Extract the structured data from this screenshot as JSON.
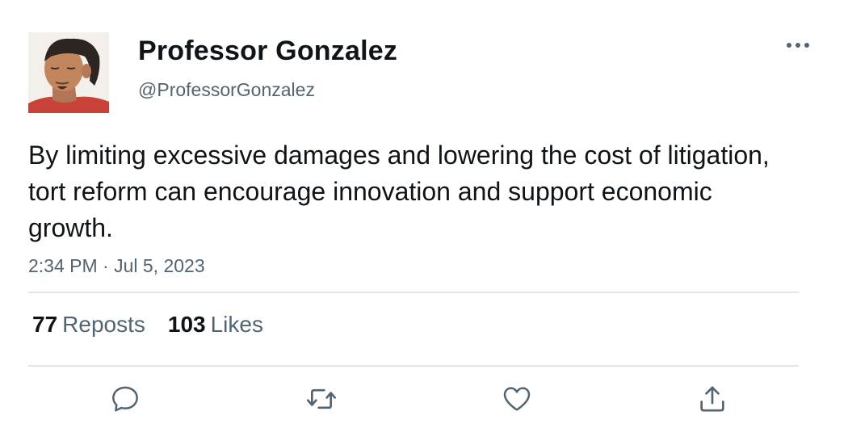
{
  "author": {
    "display_name": "Professor Gonzalez",
    "handle": "@ProfessorGonzalez",
    "avatar_icon": "profile-photo"
  },
  "tweet": {
    "text": "By limiting excessive damages and lowering the cost of litigation, tort reform can encourage innovation and support economic growth.",
    "timestamp": "2:34 PM · Jul 5, 2023"
  },
  "stats": {
    "reposts_count": "77",
    "reposts_label": "Reposts",
    "likes_count": "103",
    "likes_label": "Likes"
  },
  "actions": {
    "icons": [
      "reply-icon",
      "repost-icon",
      "like-icon",
      "share-icon"
    ]
  },
  "colors": {
    "primary_text": "#0f1419",
    "secondary_text": "#536471",
    "divider": "#e3e6e8"
  }
}
